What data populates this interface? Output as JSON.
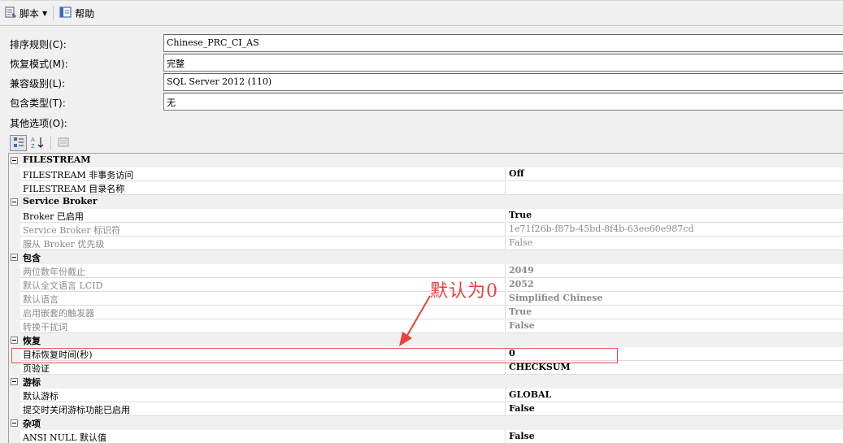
{
  "toolbar": {
    "script_label": "脚本",
    "help_label": "帮助"
  },
  "fields": [
    {
      "label": "排序规则(C):",
      "value": "Chinese_PRC_CI_AS"
    },
    {
      "label": "恢复模式(M):",
      "value": "完整"
    },
    {
      "label": "兼容级别(L):",
      "value": "SQL Server 2012 (110)"
    },
    {
      "label": "包含类型(T):",
      "value": "无"
    }
  ],
  "other_options_label": "其他选项(O):",
  "grid": {
    "categories": [
      {
        "name": "FILESTREAM",
        "props": [
          {
            "name": "FILESTREAM 非事务访问",
            "value": "Off",
            "bold": true,
            "readonly": false
          },
          {
            "name": "FILESTREAM 目录名称",
            "value": "",
            "bold": false,
            "readonly": false
          }
        ]
      },
      {
        "name": "Service Broker",
        "props": [
          {
            "name": "Broker 已启用",
            "value": "True",
            "bold": true,
            "readonly": false
          },
          {
            "name": "Service Broker 标识符",
            "value": "1e71f26b-f87b-45bd-8f4b-63ee60e987cd",
            "bold": false,
            "readonly": true
          },
          {
            "name": "服从 Broker 优先级",
            "value": "False",
            "bold": false,
            "readonly": true
          }
        ]
      },
      {
        "name": "包含",
        "props": [
          {
            "name": "两位数年份截止",
            "value": "2049",
            "bold": true,
            "readonly": true
          },
          {
            "name": "默认全文语言 LCID",
            "value": "2052",
            "bold": true,
            "readonly": true
          },
          {
            "name": "默认语言",
            "value": "Simplified Chinese",
            "bold": true,
            "readonly": true
          },
          {
            "name": "启用嵌套的触发器",
            "value": "True",
            "bold": true,
            "readonly": true
          },
          {
            "name": "转换干扰词",
            "value": "False",
            "bold": true,
            "readonly": true
          }
        ]
      },
      {
        "name": "恢复",
        "props": [
          {
            "name": "目标恢复时间(秒)",
            "value": "0",
            "bold": true,
            "readonly": false
          },
          {
            "name": "页验证",
            "value": "CHECKSUM",
            "bold": true,
            "readonly": false
          }
        ]
      },
      {
        "name": "游标",
        "props": [
          {
            "name": "默认游标",
            "value": "GLOBAL",
            "bold": true,
            "readonly": false
          },
          {
            "name": "提交时关闭游标功能已启用",
            "value": "False",
            "bold": true,
            "readonly": false
          }
        ]
      },
      {
        "name": "杂项",
        "props": [
          {
            "name": "ANSI NULL 默认值",
            "value": "False",
            "bold": true,
            "readonly": false
          }
        ]
      }
    ]
  },
  "annotation": {
    "text": "默认为0",
    "color": "#e8413c"
  }
}
